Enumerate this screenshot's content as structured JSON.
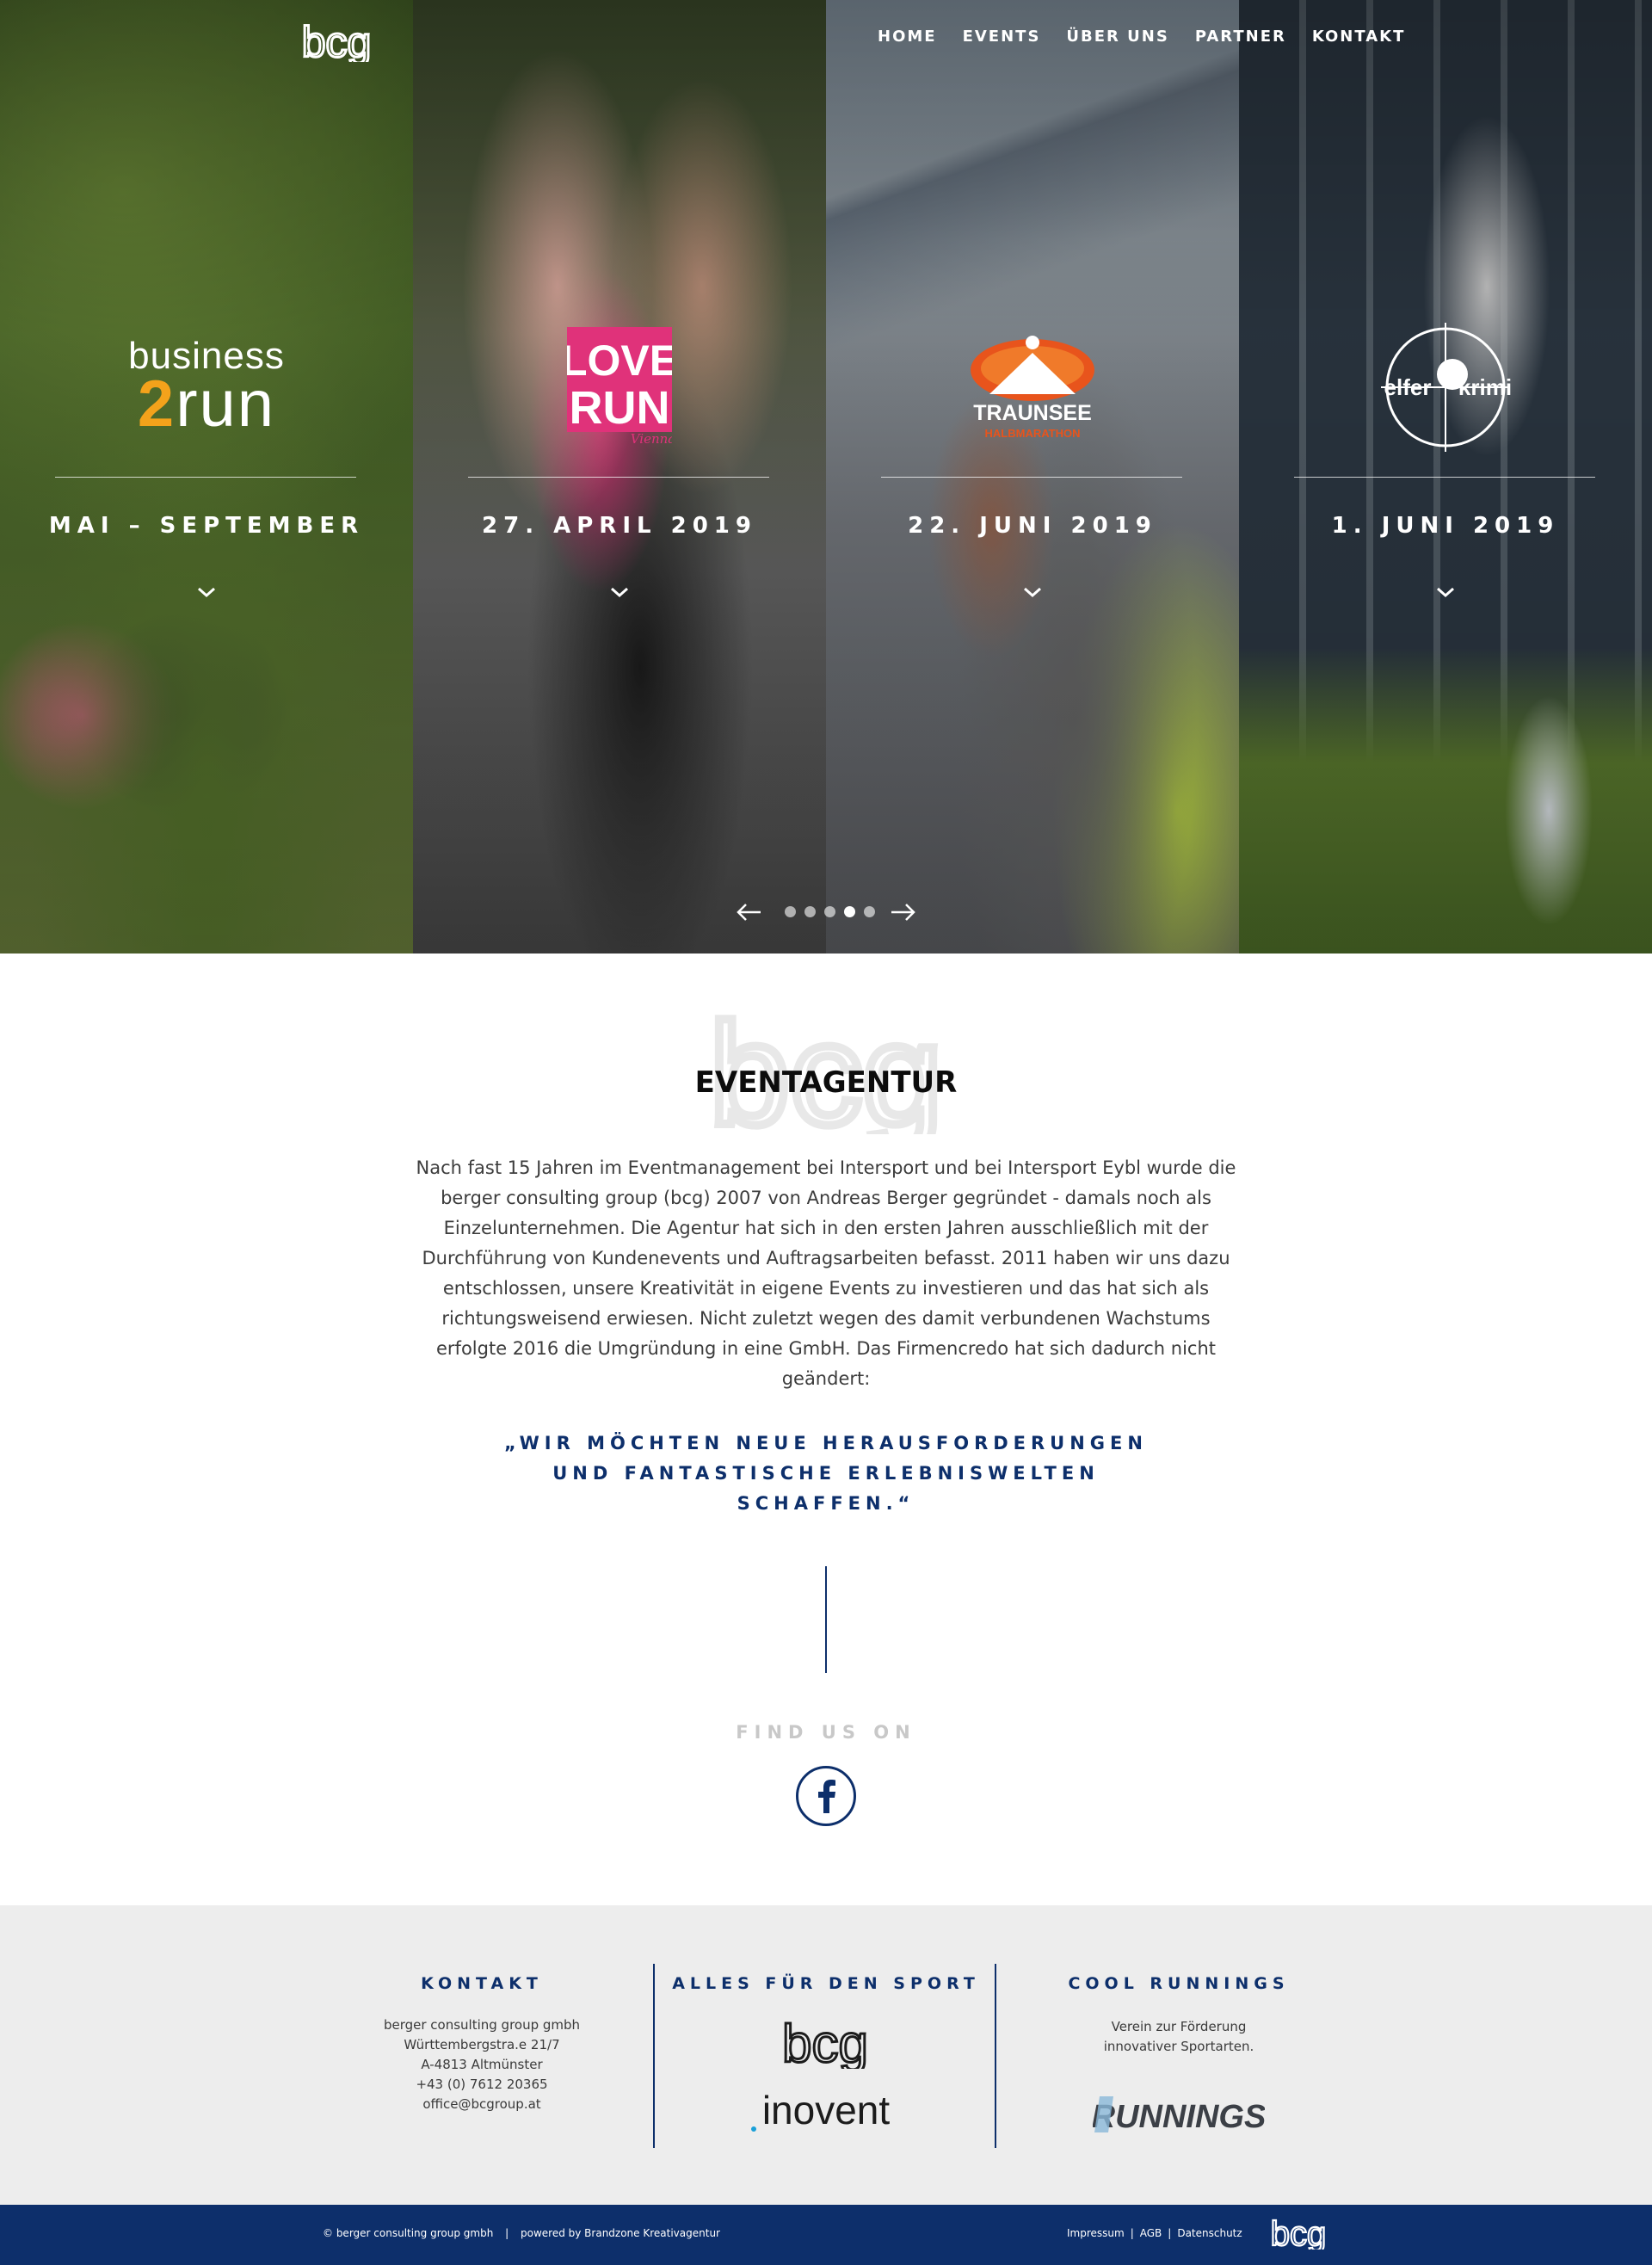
{
  "site": {
    "logo_text": "bcg",
    "nav": [
      {
        "label": "HOME"
      },
      {
        "label": "EVENTS"
      },
      {
        "label": "ÜBER UNS"
      },
      {
        "label": "PARTNER"
      },
      {
        "label": "KONTAKT"
      }
    ]
  },
  "hero": {
    "panels": [
      {
        "event": "business 2run",
        "logo_line1": "business",
        "logo_two": "2",
        "logo_rest": "run",
        "date": "MAI – SEPTEMBER"
      },
      {
        "event": "LOVE RUN Vienna",
        "logo_text": "LOVE RUN",
        "logo_script": "Vienna",
        "date": "27. APRIL 2019"
      },
      {
        "event": "TRAUNSEE HALBMARATHON",
        "logo_text": "TRAUNSEE",
        "logo_sub": "HALBMARATHON",
        "date": "22. JUNI 2019"
      },
      {
        "event": "elfer krimi",
        "logo_left": "elfer",
        "logo_right": "krimi",
        "date": "1. JUNI 2019"
      }
    ],
    "slider": {
      "dots": 5,
      "active_dot": 3,
      "prev_icon": "arrow-left-icon",
      "next_icon": "arrow-right-icon"
    }
  },
  "agency": {
    "title": "EVENTAGENTUR",
    "paragraph": "Nach fast 15 Jahren im Eventmanagement bei Intersport und bei Intersport Eybl wurde die berger consulting group (bcg) 2007 von Andreas Berger gegründet - damals noch als Einzelunternehmen. Die Agentur hat sich in den ersten Jahren ausschließlich mit der Durchführung von Kundenevents und Auftragsarbeiten befasst. 2011 haben wir uns dazu entschlossen, unsere Kreativität in eigene Events zu investieren und das hat sich als richtungsweisend erwiesen. Nicht zuletzt wegen des damit verbundenen Wachstums erfolgte 2016 die Umgründung in eine GmbH. Das Firmencredo hat sich dadurch nicht geändert:",
    "quote": "„WIR MÖCHTEN NEUE HERAUSFORDERUNGEN UND FANTASTISCHE ERLEBNISWELTEN SCHAFFEN.“",
    "find_us": "FIND US ON",
    "social_icon": "facebook-icon"
  },
  "footer": {
    "kontakt": {
      "title": "KONTAKT",
      "lines": [
        "berger consulting group gmbh",
        "Württembergstra.e 21/7",
        "A-4813 Altmünster",
        "+43 (0) 7612 20365",
        "office@bcgroup.at"
      ]
    },
    "sport": {
      "title": "ALLES FÜR DEN SPORT",
      "logo1": "bcg",
      "logo2": "inovent"
    },
    "cool": {
      "title": "COOL RUNNINGS",
      "line1": "Verein zur Förderung",
      "line2": "innovativer Sportarten.",
      "logo": "RUNNINGS"
    },
    "bottom": {
      "copyright": "© berger consulting group gmbh",
      "divider": "|",
      "powered": "powered by Brandzone Kreativagentur",
      "links": [
        "Impressum",
        "AGB",
        "Datenschutz"
      ],
      "logo_text": "bcg"
    }
  },
  "colors": {
    "navy": "#0d2f6b",
    "orange": "#f3a21b",
    "pink": "#e0327a",
    "footer_bg": "#ededed"
  }
}
